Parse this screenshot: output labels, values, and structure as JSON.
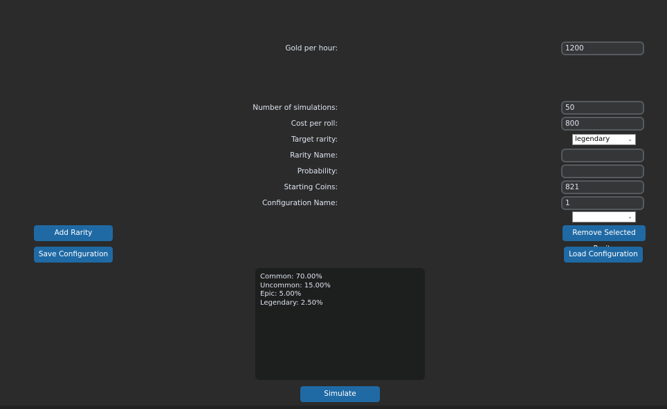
{
  "form": {
    "gold_per_hour": {
      "label": "Gold per hour:",
      "value": "1200"
    },
    "num_simulations": {
      "label": "Number of simulations:",
      "value": "50"
    },
    "cost_per_roll": {
      "label": "Cost per roll:",
      "value": "800"
    },
    "target_rarity": {
      "label": "Target rarity:",
      "selected": "legendary"
    },
    "rarity_name": {
      "label": "Rarity Name:",
      "value": ""
    },
    "probability": {
      "label": "Probability:",
      "value": ""
    },
    "starting_coins": {
      "label": "Starting Coins:",
      "value": "821"
    },
    "configuration_name": {
      "label": "Configuration Name:",
      "value": "1"
    },
    "configuration_select": {
      "selected": ""
    }
  },
  "buttons": {
    "add_rarity": "Add Rarity",
    "save_configuration": "Save Configuration",
    "remove_selected_rarity": "Remove Selected Rarity",
    "load_configuration": "Load Configuration",
    "simulate": "Simulate"
  },
  "rarity_list": [
    "Common: 70.00%",
    "Uncommon: 15.00%",
    "Epic: 5.00%",
    "Legendary: 2.50%"
  ],
  "icons": {
    "dropdown": "chevron-down-icon"
  },
  "colors": {
    "background": "#2b2b2b",
    "button": "#1f6aa5",
    "entry_bg": "#343638",
    "entry_border": "#565b5e",
    "textbox_bg": "#1d1e1e"
  }
}
